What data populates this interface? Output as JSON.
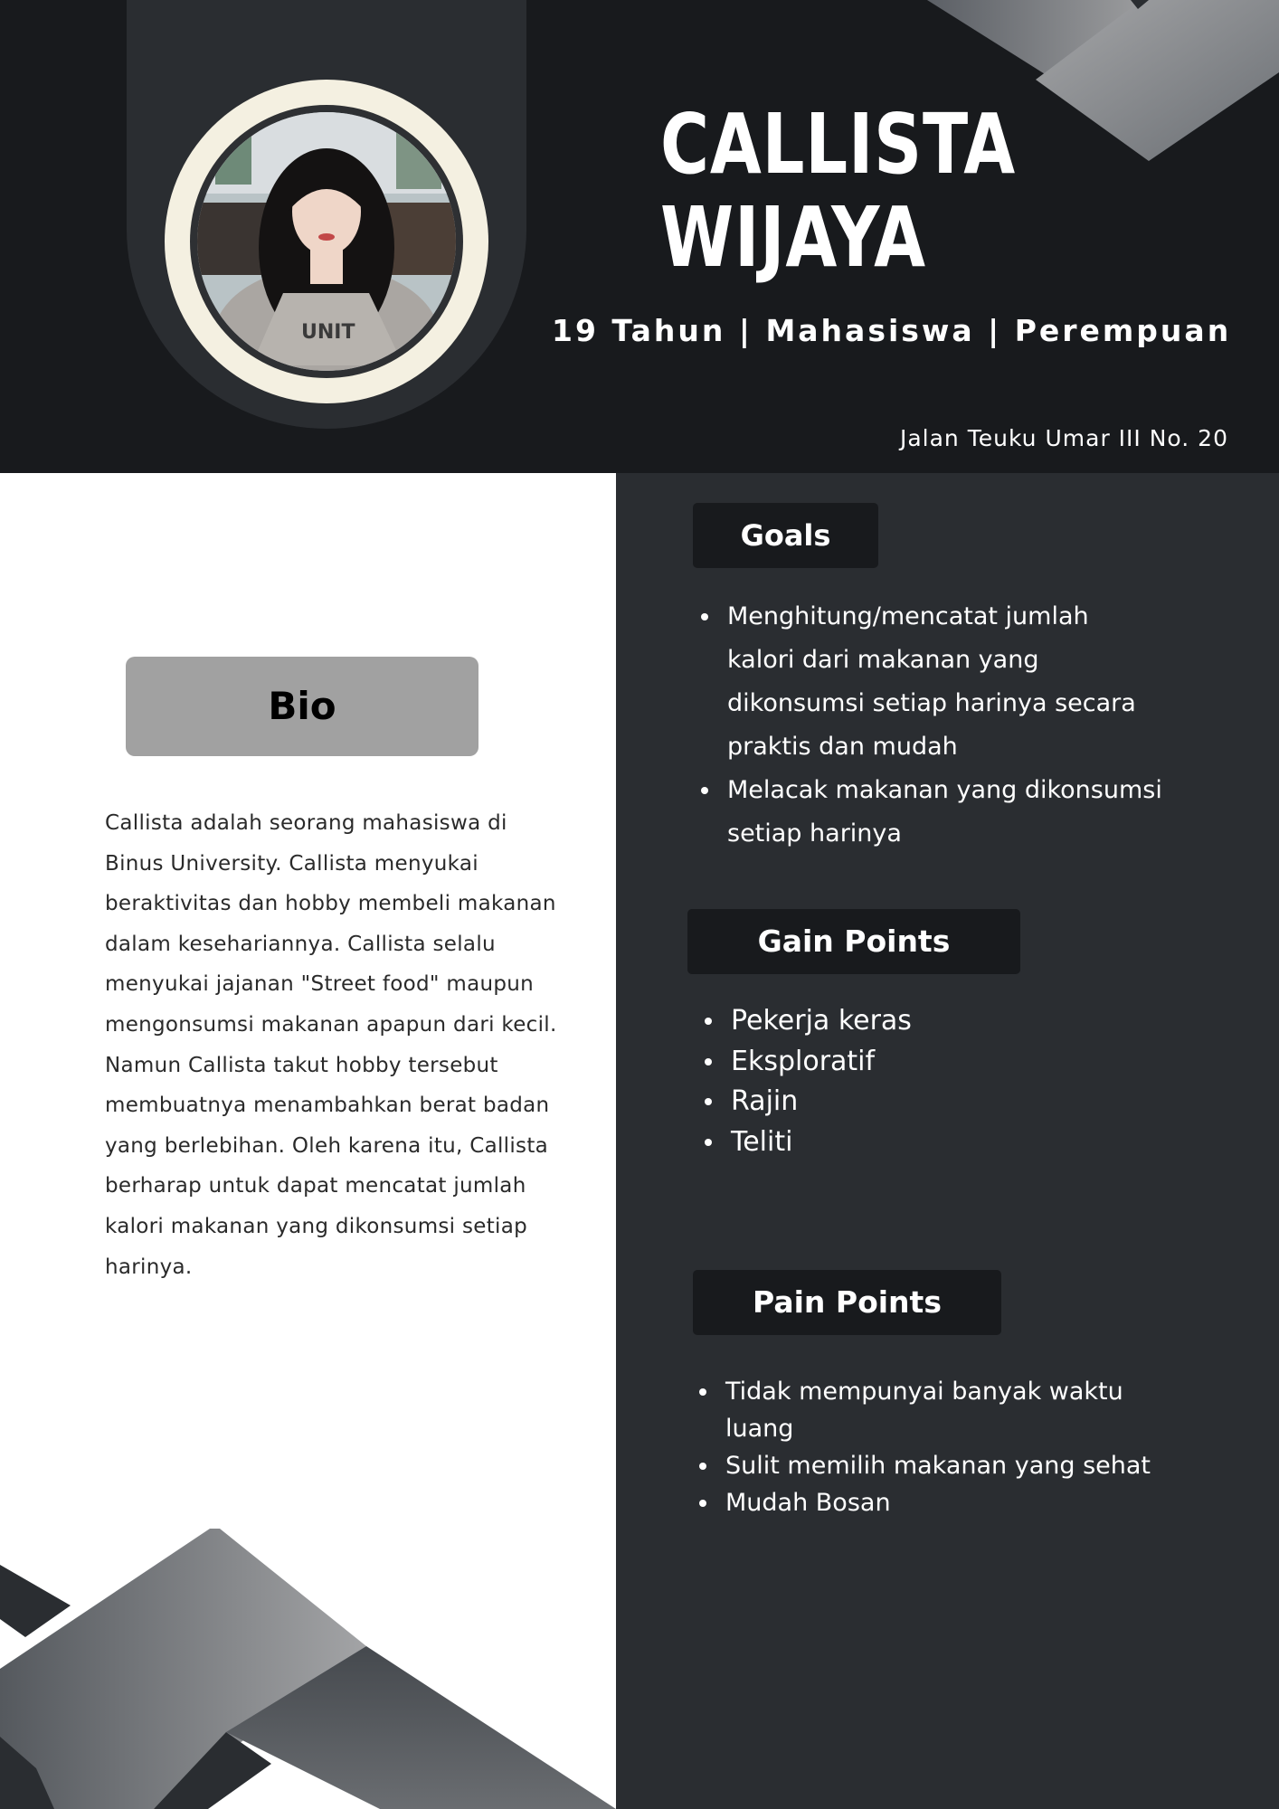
{
  "profile": {
    "name_line1": "CALLISTA",
    "name_line2": "WIJAYA",
    "details": "19 Tahun | Mahasiswa | Perempuan",
    "address": "Jalan Teuku Umar III No. 20"
  },
  "bio": {
    "title": "Bio",
    "text": "Callista adalah seorang mahasiswa di Binus University. Callista menyukai beraktivitas dan hobby membeli makanan dalam kesehariannya. Callista selalu menyukai jajanan \"Street food\" maupun mengonsumsi makanan apapun dari kecil. Namun Callista takut hobby tersebut membuatnya menambahkan berat badan yang berlebihan. Oleh karena itu, Callista berharap untuk dapat mencatat jumlah kalori makanan yang dikonsumsi setiap harinya."
  },
  "goals": {
    "title": "Goals",
    "items": [
      "Menghitung/mencatat jumlah kalori dari makanan yang dikonsumsi setiap harinya secara praktis dan mudah",
      "Melacak makanan yang dikonsumsi setiap harinya"
    ]
  },
  "gain_points": {
    "title": "Gain Points",
    "items": [
      "Pekerja keras",
      "Eksploratif",
      "Rajin",
      "Teliti"
    ]
  },
  "pain_points": {
    "title": "Pain Points",
    "items": [
      "Tidak mempunyai banyak waktu luang",
      "Sulit memilih makanan yang sehat",
      "Mudah Bosan"
    ]
  },
  "colors": {
    "header_bg": "#181a1d",
    "panel_bg": "#2a2d31",
    "ring": "#f4f0e1",
    "bio_box": "#a1a1a1"
  }
}
